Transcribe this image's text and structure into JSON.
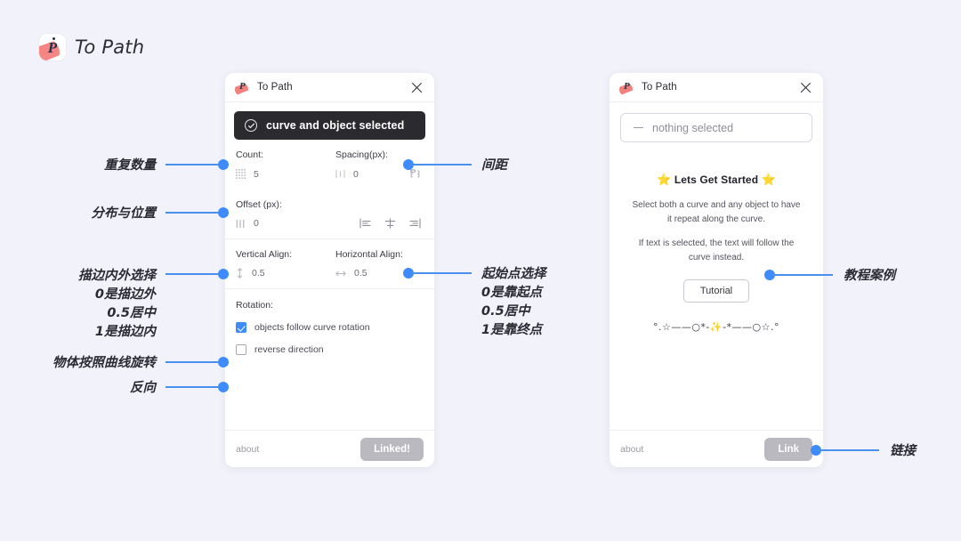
{
  "brand": {
    "name": "To Path",
    "logo_icon": "to-path-logo-icon"
  },
  "left_panel": {
    "title": "To Path",
    "close_icon": "close-icon",
    "status": {
      "icon": "check-circle-icon",
      "text": "curve and object selected"
    },
    "count": {
      "label": "Count:",
      "value": "5",
      "icon": "dot-grid-icon"
    },
    "spacing": {
      "label": "Spacing(px):",
      "value": "0",
      "icon": "spacing-icon",
      "link_icon": "link-chain-icon"
    },
    "offset": {
      "label": "Offset (px):",
      "value": "0",
      "icon": "bars-icon"
    },
    "align_buttons": [
      {
        "name": "align-left-icon",
        "title": "align left"
      },
      {
        "name": "align-center-icon",
        "title": "align center"
      },
      {
        "name": "align-right-icon",
        "title": "align right"
      }
    ],
    "vertical_align": {
      "label": "Vertical Align:",
      "value": "0.5",
      "icon": "arrows-vertical-icon"
    },
    "horizontal_align": {
      "label": "Horizontal Align:",
      "value": "0.5",
      "icon": "arrows-horizontal-icon"
    },
    "rotation": {
      "label": "Rotation:"
    },
    "checkbox_follow": {
      "label": "objects follow curve rotation",
      "checked": true
    },
    "checkbox_reverse": {
      "label": "reverse direction",
      "checked": false
    },
    "footer": {
      "about": "about",
      "button": "Linked!"
    }
  },
  "right_panel": {
    "title": "To Path",
    "close_icon": "close-icon",
    "status": {
      "icon": "dash-icon",
      "text": "nothing selected"
    },
    "heading": "Lets Get Started",
    "heading_star": "⭐",
    "help_1": "Select both a curve and any object to have it repeat along the curve.",
    "help_2": "If text is selected, the text will follow the curve instead.",
    "tutorial_button": "Tutorial",
    "decoration": "°.☆——○*-✨-*——○☆.°",
    "footer": {
      "about": "about",
      "button": "Link"
    }
  },
  "annotations": {
    "accent_color": "#3d8bfd",
    "items": [
      {
        "id": "count",
        "text": "重复数量"
      },
      {
        "id": "offset",
        "text": "分布与位置"
      },
      {
        "id": "valign",
        "text": "描边内外选择\n0是描边外\n0.5居中\n1是描边内"
      },
      {
        "id": "rotation",
        "text": "物体按照曲线旋转"
      },
      {
        "id": "reverse",
        "text": "反向"
      },
      {
        "id": "spacing",
        "text": "间距"
      },
      {
        "id": "halign",
        "text": "起始点选择\n0是靠起点\n0.5居中\n1是靠终点"
      },
      {
        "id": "tutorial",
        "text": "教程案例"
      },
      {
        "id": "link",
        "text": "链接"
      }
    ]
  }
}
